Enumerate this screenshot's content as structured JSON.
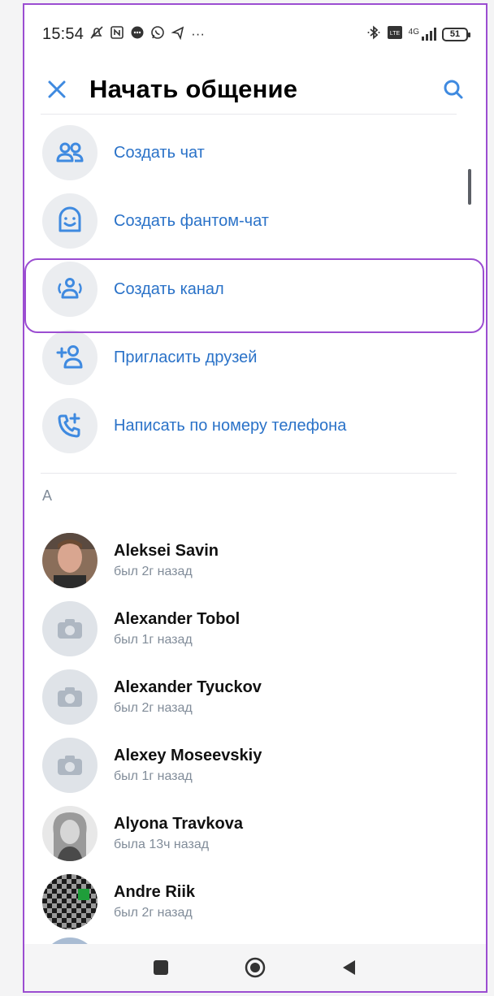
{
  "status_bar": {
    "time": "15:54",
    "more": "···",
    "network": "4G",
    "battery": "51"
  },
  "header": {
    "title": "Начать общение"
  },
  "actions": [
    {
      "label": "Создать чат",
      "icon": "group-icon"
    },
    {
      "label": "Создать фантом-чат",
      "icon": "phantom-face-icon"
    },
    {
      "label": "Создать канал",
      "icon": "channel-icon"
    },
    {
      "label": "Пригласить друзей",
      "icon": "add-user-icon"
    },
    {
      "label": "Написать по номеру телефона",
      "icon": "phone-add-icon"
    }
  ],
  "section": {
    "letter": "А"
  },
  "contacts": [
    {
      "name": "Aleksei Savin",
      "status": "был 2г назад",
      "avatar": "photo"
    },
    {
      "name": "Alexander Tobol",
      "status": "был 1г назад",
      "avatar": "camera-placeholder"
    },
    {
      "name": "Alexander Tyuckov",
      "status": "был 2г назад",
      "avatar": "camera-placeholder"
    },
    {
      "name": "Alexey Moseevskiy",
      "status": "был 1г назад",
      "avatar": "camera-placeholder"
    },
    {
      "name": "Alyona Travkova",
      "status": "была 13ч назад",
      "avatar": "photo"
    },
    {
      "name": "Andre Riik",
      "status": "был 2г назад",
      "avatar": "checkered-pattern"
    }
  ],
  "colors": {
    "accent": "#2a72c8",
    "icon_blue": "#3f8ae0",
    "secondary_text": "#818c99",
    "highlight": "#9b4dd1"
  }
}
